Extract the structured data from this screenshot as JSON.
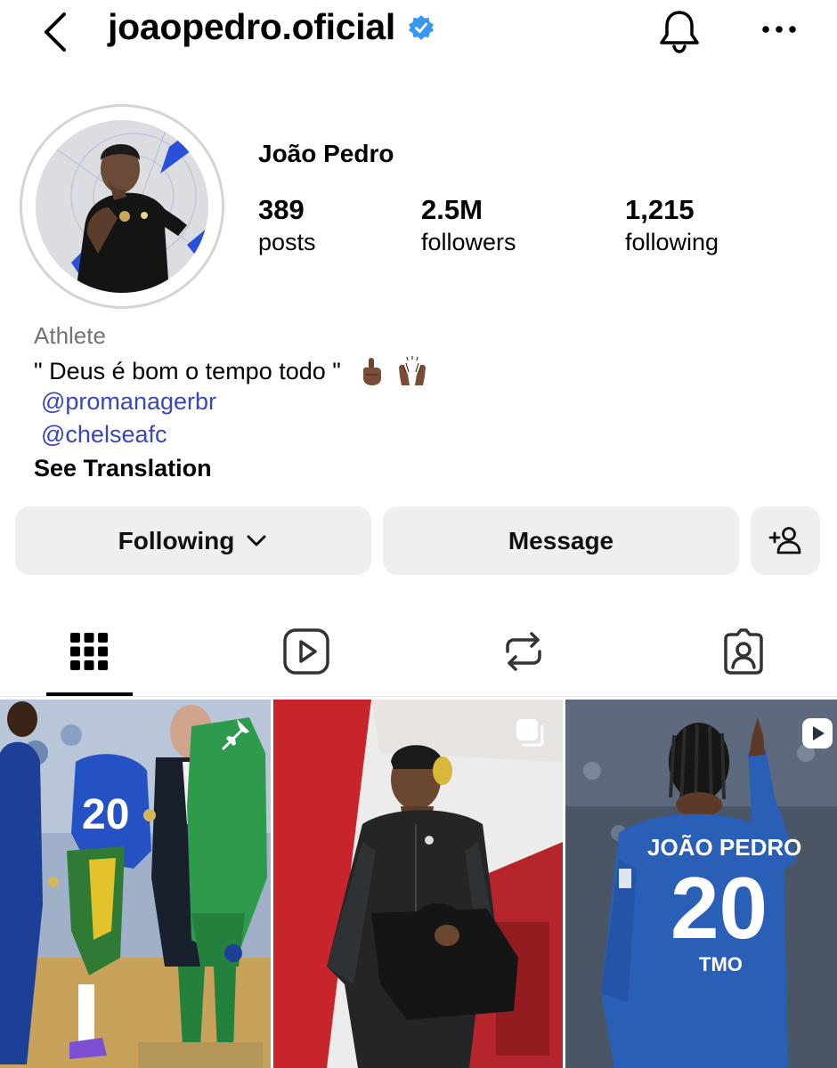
{
  "header": {
    "username": "joaopedro.oficial"
  },
  "profile": {
    "display_name": "João Pedro",
    "stats": [
      {
        "value": "389",
        "label": "posts"
      },
      {
        "value": "2.5M",
        "label": "followers"
      },
      {
        "value": "1,215",
        "label": "following"
      }
    ],
    "category": "Athlete",
    "bio": "\" Deus é bom o tempo todo \"",
    "links": [
      "@promanagerbr",
      "@chelseafc"
    ],
    "see_translation": "See Translation"
  },
  "actions": {
    "following_label": "Following",
    "message_label": "Message"
  },
  "tabs": [
    {
      "icon": "grid-icon",
      "selected": true
    },
    {
      "icon": "reels-icon",
      "selected": false
    },
    {
      "icon": "reposts-icon",
      "selected": false
    },
    {
      "icon": "tagged-icon",
      "selected": false
    }
  ],
  "posts": [
    {
      "badge": "pin-icon"
    },
    {
      "badge": "carousel-icon"
    },
    {
      "badge": "reel-icon",
      "jersey_name": "JOÃO PEDRO",
      "jersey_number": "20",
      "sponsor": "TMO"
    }
  ],
  "colors": {
    "link": "#3b47b8",
    "verified": "#3897f0",
    "button_bg": "#efeff0",
    "chelsea_blue": "#1f4fa3"
  }
}
